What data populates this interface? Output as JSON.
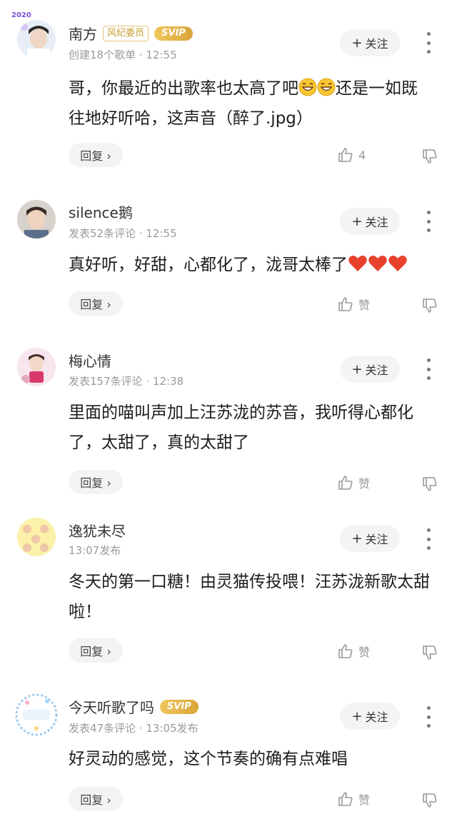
{
  "comments": [
    {
      "name": "南方",
      "tag": "风纪委员",
      "svip": "SVIP",
      "meta": "创建18个歌单 · 12:55",
      "follow": "关注",
      "text_1": "哥，你最近的出歌率也太高了吧",
      "text_2": "还是一如既",
      "text_3": "往地好听哈，这声音（醉了.jpg）",
      "reply": "回复 ›",
      "like": "4",
      "avatar_badge": "2020"
    },
    {
      "name": "silence鹅",
      "meta": "发表52条评论 · 12:55",
      "follow": "关注",
      "text_1": "真好听，好甜，心都化了，泷哥太棒了",
      "reply": "回复 ›",
      "like": "赞"
    },
    {
      "name": "梅心情",
      "meta": "发表157条评论 · 12:38",
      "follow": "关注",
      "text_1": "里面的喵叫声加上汪苏泷的苏音，我听得心都化",
      "text_2": "了，太甜了，真的太甜了",
      "reply": "回复 ›",
      "like": "赞"
    },
    {
      "name": "逸犹未尽",
      "meta": "13:07发布",
      "follow": "关注",
      "text_1": "冬天的第一口糖！由灵猫传投喂！汪苏泷新歌太甜",
      "text_2": "啦！",
      "reply": "回复 ›",
      "like": "赞"
    },
    {
      "name": "今天听歌了吗",
      "svip": "SVIP",
      "meta": "发表47条评论 · 13:05发布",
      "follow": "关注",
      "text_1": "好灵动的感觉，这个节奏的确有点难唱",
      "reply": "回复 ›",
      "like": "赞"
    }
  ],
  "colors": {
    "svip": "#e0b04a",
    "heart": "#e8412c",
    "muted": "#999999"
  }
}
